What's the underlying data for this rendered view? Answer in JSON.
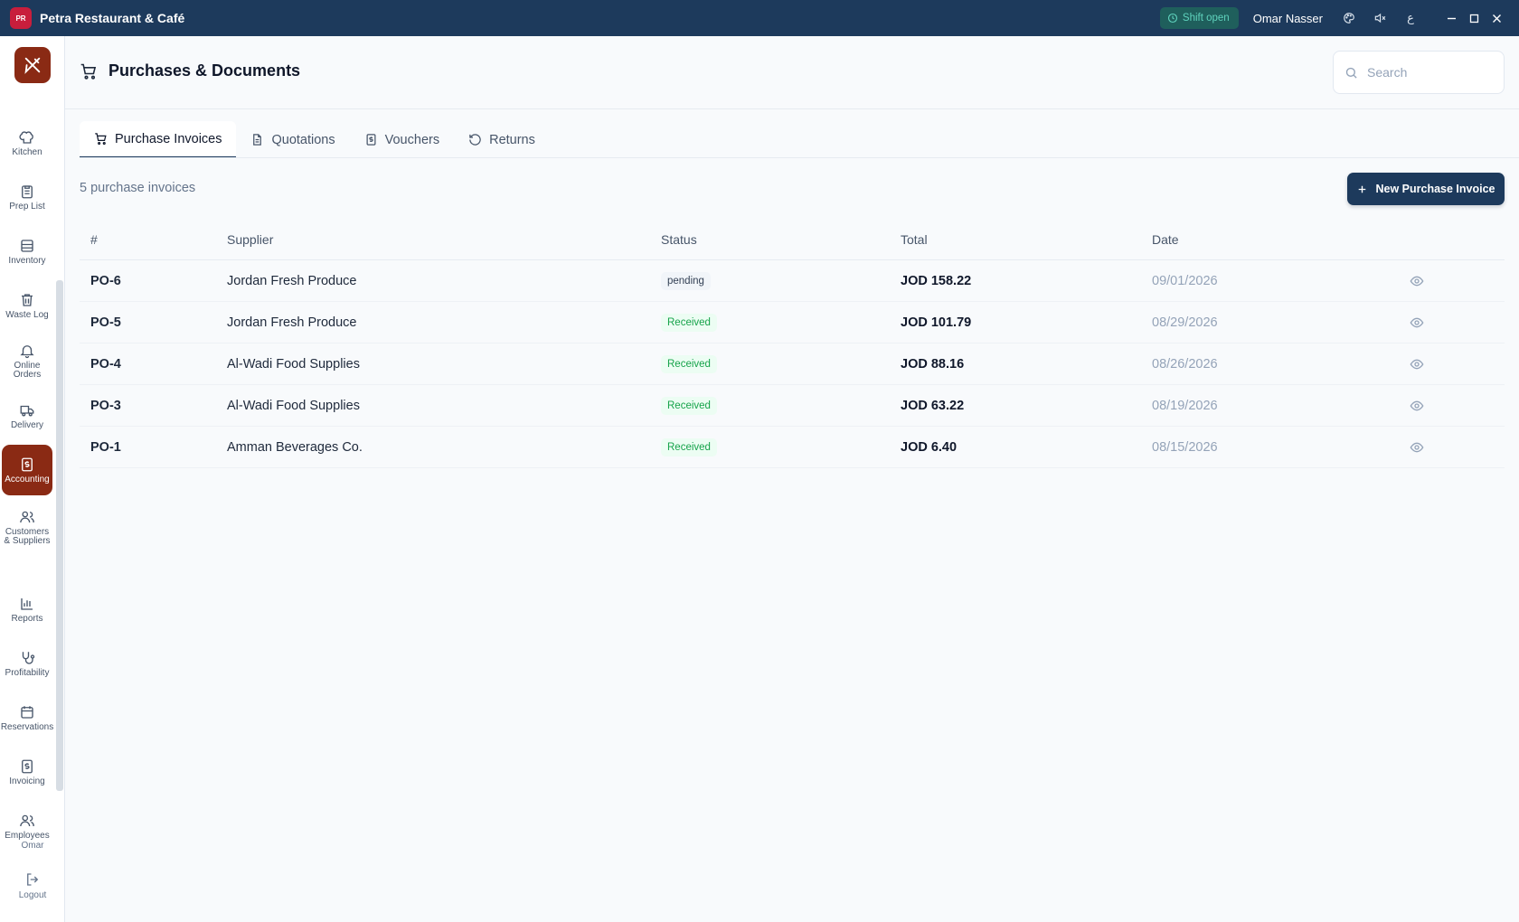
{
  "window": {
    "app_logo": "PR",
    "title": "Petra Restaurant & Café",
    "shift_status": "Shift open",
    "user": "Omar Nasser",
    "lang_label": "ع"
  },
  "sidebar": {
    "items": [
      {
        "label": "Kitchen",
        "icon": "chef-hat-icon"
      },
      {
        "label": "Prep List",
        "icon": "clipboard-icon"
      },
      {
        "label": "Inventory",
        "icon": "archive-icon"
      },
      {
        "label": "Waste Log",
        "icon": "trash-icon"
      },
      {
        "label": "Online Orders",
        "icon": "bell-icon"
      },
      {
        "label": "Delivery",
        "icon": "truck-icon"
      },
      {
        "label": "Accounting",
        "icon": "receipt-dollar-icon"
      },
      {
        "label": "Customers & Suppliers",
        "icon": "users-icon"
      },
      {
        "label": "Reports",
        "icon": "bar-chart-icon"
      },
      {
        "label": "Profitability",
        "icon": "stethoscope-icon"
      },
      {
        "label": "Reservations",
        "icon": "calendar-icon"
      },
      {
        "label": "Invoicing",
        "icon": "receipt-icon"
      },
      {
        "label": "Employees",
        "icon": "users-icon"
      }
    ],
    "user_short": "Omar",
    "logout_label": "Logout"
  },
  "header": {
    "title": "Purchases & Documents",
    "search_placeholder": "Search"
  },
  "tabs": [
    {
      "label": "Purchase Invoices",
      "active": true
    },
    {
      "label": "Quotations",
      "active": false
    },
    {
      "label": "Vouchers",
      "active": false
    },
    {
      "label": "Returns",
      "active": false
    }
  ],
  "toolbar": {
    "count_text": "5 purchase invoices",
    "new_button": "New Purchase Invoice"
  },
  "table": {
    "columns": [
      "#",
      "Supplier",
      "Status",
      "Total",
      "Date"
    ],
    "rows": [
      {
        "num": "PO-6",
        "supplier": "Jordan Fresh Produce",
        "status": "pending",
        "total": "JOD 158.22",
        "date": "09/01/2026"
      },
      {
        "num": "PO-5",
        "supplier": "Jordan Fresh Produce",
        "status": "Received",
        "total": "JOD 101.79",
        "date": "08/29/2026"
      },
      {
        "num": "PO-4",
        "supplier": "Al-Wadi Food Supplies",
        "status": "Received",
        "total": "JOD 88.16",
        "date": "08/26/2026"
      },
      {
        "num": "PO-3",
        "supplier": "Al-Wadi Food Supplies",
        "status": "Received",
        "total": "JOD 63.22",
        "date": "08/19/2026"
      },
      {
        "num": "PO-1",
        "supplier": "Amman Beverages Co.",
        "status": "Received",
        "total": "JOD 6.40",
        "date": "08/15/2026"
      }
    ]
  },
  "colors": {
    "titlebar": "#1d3a5c",
    "accent_active": "#8a2a14",
    "primary_button": "#1d3a5c",
    "received": "#16a34a"
  }
}
